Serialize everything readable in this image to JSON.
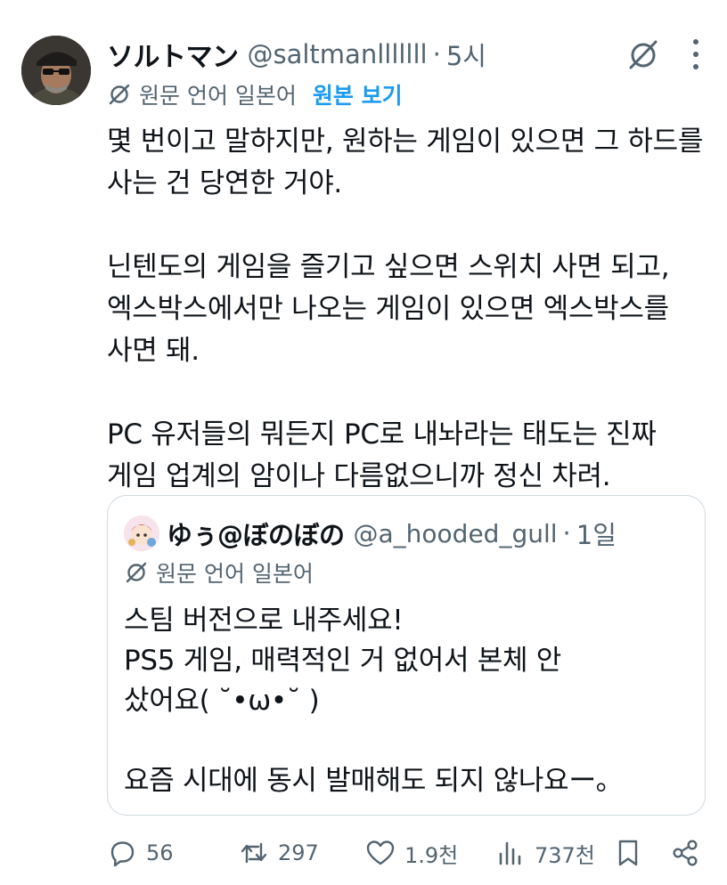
{
  "tweet": {
    "author_name": "ソルトマン",
    "author_handle": "@saltmanlllllll",
    "separator": "·",
    "time": "5시",
    "translation": {
      "label": "원문 언어 일본어",
      "show_original": "원본 보기"
    },
    "text_lines": [
      "몇 번이고 말하지만, 원하는 게임이 있으면 그 하드를",
      "사는 건 당연한 거야.",
      "",
      "닌텐도의 게임을 즐기고 싶으면 스위치 사면 되고,",
      "엑스박스에서만 나오는 게임이 있으면 엑스박스를",
      "사면 돼.",
      "",
      "PC 유저들의 뭐든지 PC로 내놔라는 태도는 진짜",
      "게임 업계의 암이나 다름없으니까 정신 차려."
    ]
  },
  "quoted": {
    "author_name": "ゆぅ@ぼのぼの",
    "author_handle": "@a_hooded_gull",
    "separator": "·",
    "time": "1일",
    "translation_label": "원문 언어 일본어",
    "text_lines": [
      "스팀 버전으로 내주세요!",
      "PS5 게임, 매력적인 거 없어서 본체 안",
      "샀어요( ˘•ω•˘ )",
      "",
      "요즘 시대에 동시 발매해도 되지 않나요ー。"
    ]
  },
  "actions": {
    "replies": "56",
    "reposts": "297",
    "likes": "1.9천",
    "views": "737천"
  },
  "colors": {
    "text": "#0f1419",
    "secondary": "#536471",
    "link": "#1d9bf0",
    "border": "#cfd9de"
  },
  "icons": [
    "grok-icon",
    "more-icon",
    "translate-icon",
    "reply-icon",
    "repost-icon",
    "like-icon",
    "views-icon",
    "bookmark-icon",
    "share-icon"
  ]
}
